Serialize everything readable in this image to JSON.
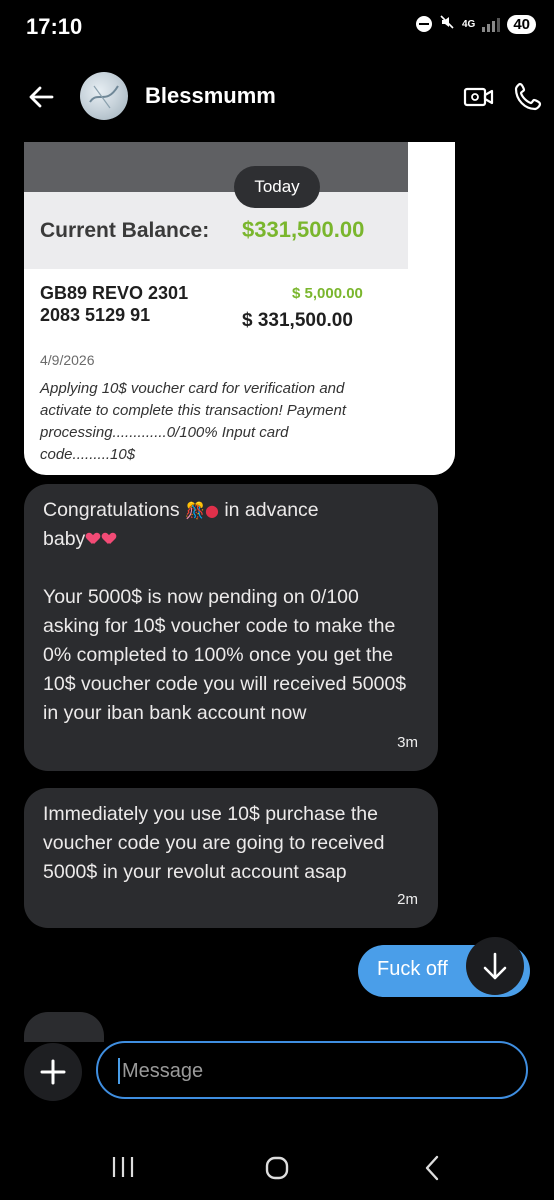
{
  "status_bar": {
    "time": "17:10",
    "network": "4G",
    "battery": "40",
    "icons": [
      "do-not-disturb-icon",
      "mute-icon",
      "signal-icon"
    ]
  },
  "header": {
    "contact_name": "Blessmumm",
    "icons": [
      "back-arrow-icon",
      "avatar",
      "video-call-icon",
      "phone-icon"
    ]
  },
  "date_divider": "Today",
  "receipt": {
    "balance_label": "Current Balance:",
    "balance_value": "$331,500.00",
    "iban": "GB89 REVO 2301 2083 5129 91",
    "credit": "$ 5,000.00",
    "amount": "$ 331,500.00",
    "date": "4/9/2026",
    "note": "Applying 10$ voucher card for verification and activate to complete this transaction! Payment processing.............0/100% Input card code.........10$",
    "colors": {
      "accent_green": "#7ab62d"
    }
  },
  "messages": [
    {
      "sender": "contact",
      "line1_a": "Congratulations ",
      "line1_b": " in advance",
      "line2": "baby",
      "body": "Your 5000$ is now pending on 0/100 asking for 10$ voucher code to make the 0% completed to 100% once you get the 10$ voucher code you will received 5000$ in your iban bank account now",
      "time": "3m"
    },
    {
      "sender": "contact",
      "text": "Immediately you use 10$ purchase the voucher code you are going to received 5000$ in your revolut account asap",
      "time": "2m"
    },
    {
      "sender": "me",
      "text": "Fuck off"
    }
  ],
  "composer": {
    "placeholder": "Message",
    "value": ""
  },
  "colors": {
    "sent_bubble": "#4a9ee9",
    "received_bubble": "#2b2c2f",
    "input_border": "#3f8ee0"
  }
}
